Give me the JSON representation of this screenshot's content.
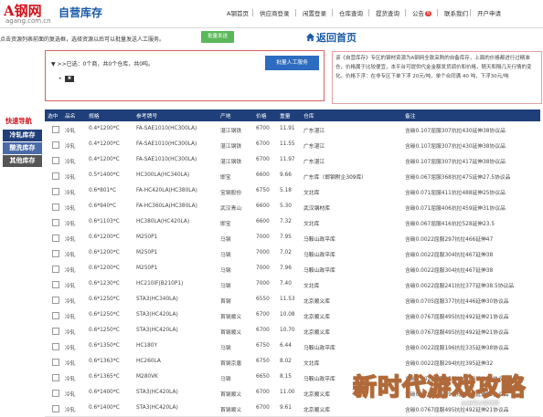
{
  "logo": {
    "text": "A钢网",
    "subtext": "agang.com.cn"
  },
  "site_title": "自营库存",
  "nav": [
    {
      "label": "A钢首页"
    },
    {
      "label": "供应商登录"
    },
    {
      "label": "闲置登录"
    },
    {
      "label": "仓库查询"
    },
    {
      "label": "提货查询"
    },
    {
      "label": "公告",
      "badge": "6"
    },
    {
      "label": "联系我们"
    },
    {
      "label": "开户申请"
    }
  ],
  "hint": {
    "text": "点击资源列表前面的复选框，选择资源以后可以批量发送人工服务。",
    "button": "批量发送"
  },
  "home_link": "返回首页",
  "selection": {
    "prefix": ">>已选：",
    "count_text": "0个商，共0个仓库，共0吨。",
    "bullet": "•",
    "remove": "✖",
    "manual_button": "批量人工服务"
  },
  "notice": "该《自营库存》专区的钢材资源为A钢网全款采购的自备库存，上面的价格都进行过精准仓，价格属于比较便宜，本平台可提供代金金额发货调价和价格，随天和隔几天行情的变化。价格下浮：在非专区下单下浮 20元/吨，单个合同满 40 吨，下浮30元/吨",
  "sidebar": {
    "title": "快速导航",
    "items": [
      {
        "label": "冷轧库存",
        "color": "#1f3f7a"
      },
      {
        "label": "酸洗库存",
        "color": "#4a6aa8"
      },
      {
        "label": "其他库存",
        "color": "#555555"
      }
    ]
  },
  "table": {
    "headers": [
      "选中",
      "品名",
      "规格",
      "参考牌号",
      "产地",
      "价格",
      "重量",
      "仓库",
      "备注"
    ],
    "rows": [
      [
        "冷轧",
        "0.4*1200*C",
        "FA-SAE1010(HC300LA)",
        "湛江钢铁",
        "6700",
        "11.91",
        "广东湛江",
        "含碳0.107屈服307抗拉430延伸38协议品"
      ],
      [
        "冷轧",
        "0.4*1200*C",
        "FA-SAE1010(HC300LA)",
        "湛江钢铁",
        "6700",
        "11.55",
        "广东湛江",
        "含碳0.107屈服307抗拉430延伸38协议品"
      ],
      [
        "冷轧",
        "0.4*1200*C",
        "FA-SAE1010(HC300LA)",
        "湛江钢铁",
        "6700",
        "11.97",
        "广东湛江",
        "含碳0.107屈服307抗拉417延伸38协议品"
      ],
      [
        "冷轧",
        "0.5*1400*C",
        "HC300LA(HC340LA)",
        "邯宝",
        "6600",
        "9.66",
        "广东库（邯钢附企309库）",
        "含碳0.067屈服368抗拉475延伸27.5协议品"
      ],
      [
        "冷轧",
        "0.6*801*C",
        "FA-HC420LA(HC380LA)",
        "宝钢股份",
        "6750",
        "5.18",
        "文北库",
        "含碳0.071屈服411抗拉488延伸25协议品"
      ],
      [
        "冷轧",
        "0.6*940*C",
        "FA-HC360LA(HC380LA)",
        "武汉青山",
        "6600",
        "5.30",
        "武汉钢材库",
        "含碳0.071屈服406抗拉459延伸31协议品"
      ],
      [
        "冷轧",
        "0.6*1103*C",
        "HC380LA(HC420LA)",
        "邯宝",
        "6600",
        "7.32",
        "文北库",
        "含碳0.067屈服416抗拉528延伸23.5"
      ],
      [
        "冷轧",
        "0.6*1200*C",
        "M250P1",
        "马钢",
        "7000",
        "7.95",
        "马鞍山政平库",
        "含碳0.0022屈服297抗拉466延伸47"
      ],
      [
        "冷轧",
        "0.6*1200*C",
        "M250P1",
        "马钢",
        "7000",
        "7.02",
        "马鞍山政平库",
        "含碳0.0022屈服304抗拉467延伸38"
      ],
      [
        "冷轧",
        "0.6*1200*C",
        "M250P1",
        "马钢",
        "7000",
        "7.96",
        "马鞍山政平库",
        "含碳0.0022屈服304抗拉467延伸38"
      ],
      [
        "冷轧",
        "0.6*1230*C",
        "HC210IF(B210P1)",
        "马钢",
        "7000",
        "7.40",
        "文北库",
        "含碳0.0022屈服241抗拉377延伸38.5协议品"
      ],
      [
        "冷轧",
        "0.6*1250*C",
        "STA3(HC340LA)",
        "首钢",
        "6550",
        "11.53",
        "北京顺义库",
        "含碳0.0705屈服377抗拉446延伸30协议品"
      ],
      [
        "冷轧",
        "0.6*1250*C",
        "STA3(HC420LA)",
        "首钢顺义",
        "6700",
        "10.08",
        "北京顺义库",
        "含碳0.0767屈服495抗拉492延伸21协议品"
      ],
      [
        "冷轧",
        "0.6*1250*C",
        "STA3(HC420LA)",
        "首钢顺义",
        "6700",
        "10.70",
        "北京顺义库",
        "含碳0.0767屈服495抗拉492延伸21协议品"
      ],
      [
        "冷轧",
        "0.6*1350*C",
        "HC180Y",
        "马钢",
        "6750",
        "6.44",
        "马鞍山政平库",
        "含碳0.0022屈服196抗拉335延伸38协议品"
      ],
      [
        "冷轧",
        "0.6*1363*C",
        "HC260LA",
        "首钢京唐",
        "6750",
        "8.02",
        "文北库",
        "含碳0.0022屈服294抗拉395延伸32"
      ],
      [
        "冷轧",
        "0.6*1365*C",
        "M280VK",
        "马钢",
        "6650",
        "8.15",
        "马鞍山政平库",
        "含碳0.0022屈服257抗拉483延伸38协议品"
      ],
      [
        "冷轧",
        "0.6*1400*C",
        "STA3(HC420LA)",
        "首钢顺义",
        "6700",
        "11.00",
        "北京顺义库",
        "含碳0.0767屈服495抗拉492延伸21协议品"
      ],
      [
        "冷轧",
        "0.6*1400*C",
        "STA3(HC420LA)",
        "首钢顺义",
        "6700",
        "9.61",
        "北京顺义库",
        "含碳0.0767屈服495抗拉492延伸21协议品"
      ]
    ]
  },
  "watermark": {
    "text": "新时代游戏攻略",
    "sub": "@迪诺沙游戏网"
  }
}
